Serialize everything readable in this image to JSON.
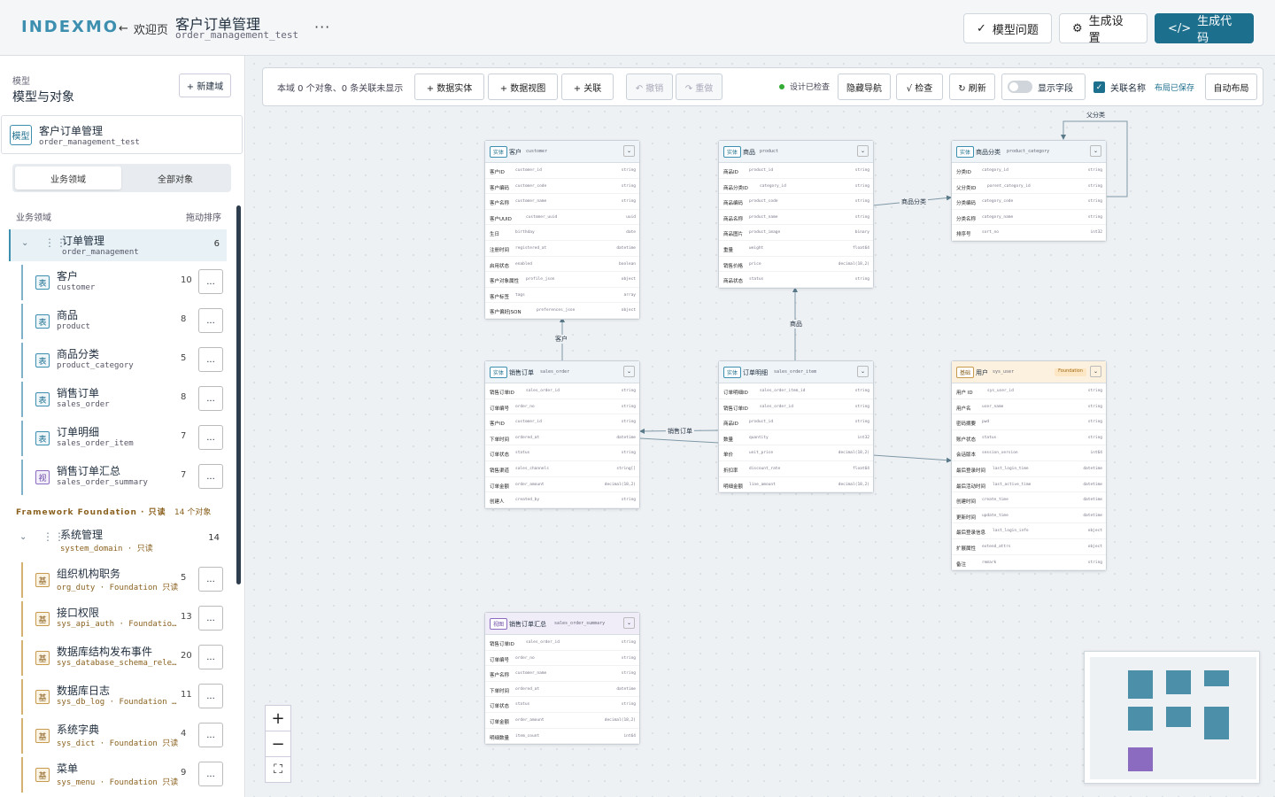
{
  "header": {
    "logo": "INDEXMO",
    "back_label": "欢迎页",
    "title": "客户订单管理",
    "subtitle": "order_management_test",
    "more": "···",
    "buttons": {
      "model_issues": "模型问题",
      "gen_settings": "生成设置",
      "gen_code": "生成代码"
    }
  },
  "sidebar": {
    "top_label": "模型",
    "top_title": "模型与对象",
    "new_domain": "+ 新建域",
    "model": {
      "badge": "模型",
      "name": "客户订单管理",
      "code": "order_management_test"
    },
    "tabs": [
      "业务领域",
      "全部对象"
    ],
    "domain_header": "业务领域",
    "drag_header": "拖动排序",
    "domain": {
      "name": "订单管理",
      "code": "order_management",
      "count": "6"
    },
    "entities": [
      {
        "badge": "表",
        "name": "客户",
        "code": "customer",
        "count": "10"
      },
      {
        "badge": "表",
        "name": "商品",
        "code": "product",
        "count": "8"
      },
      {
        "badge": "表",
        "name": "商品分类",
        "code": "product_category",
        "count": "5"
      },
      {
        "badge": "表",
        "name": "销售订单",
        "code": "sales_order",
        "count": "8"
      },
      {
        "badge": "表",
        "name": "订单明细",
        "code": "sales_order_item",
        "count": "7"
      },
      {
        "badge": "视",
        "name": "销售订单汇总",
        "code": "sales_order_summary",
        "count": "7"
      }
    ],
    "framework_header": "Framework Foundation · 只读",
    "framework_count": "14 个对象",
    "fw_domain": {
      "name": "系统管理",
      "code": "system_domain · 只读",
      "count": "14"
    },
    "fw_entities": [
      {
        "badge": "基",
        "name": "组织机构职务",
        "code": "org_duty · Foundation 只读",
        "count": "5"
      },
      {
        "badge": "基",
        "name": "接口权限",
        "code": "sys_api_auth · Foundatio…",
        "count": "13"
      },
      {
        "badge": "基",
        "name": "数据库结构发布事件",
        "code": "sys_database_schema_rele…",
        "count": "20"
      },
      {
        "badge": "基",
        "name": "数据库日志",
        "code": "sys_db_log · Foundation …",
        "count": "11"
      },
      {
        "badge": "基",
        "name": "系统字典",
        "code": "sys_dict · Foundation 只读",
        "count": "4"
      },
      {
        "badge": "基",
        "name": "菜单",
        "code": "sys_menu · Foundation 只读",
        "count": "9"
      }
    ],
    "dots": "..."
  },
  "toolbar": {
    "info": "本域 0 个对象、0 条关联未显示",
    "add_entity": "+ 数据实体",
    "add_view": "+ 数据视图",
    "add_rel": "+ 关联",
    "undo": "↶ 撤销",
    "redo": "↷ 重做",
    "check_status": "设计已检查",
    "hide_nav": "隐藏导航",
    "check": "√ 检查",
    "refresh": "↻ 刷新",
    "show_fields": "显示字段",
    "rel_names": "关联名称",
    "saved": "布局已保存",
    "auto_layout": "自动布局"
  },
  "edges": {
    "customer": "客户",
    "product": "商品",
    "category": "商品分类",
    "parent": "父分类",
    "order": "销售订单"
  },
  "cards": {
    "customer": {
      "tag": "实体",
      "name": "客户",
      "code": "customer",
      "fields": [
        [
          "客户ID",
          "customer_id",
          "string"
        ],
        [
          "客户编码",
          "customer_code",
          "string"
        ],
        [
          "客户名称",
          "customer_name",
          "string"
        ],
        [
          "客户UUID",
          "customer_uuid",
          "uuid"
        ],
        [
          "生日",
          "birthday",
          "date"
        ],
        [
          "注册时间",
          "registered_at",
          "datetime"
        ],
        [
          "启用状态",
          "enabled",
          "boolean"
        ],
        [
          "客户对象属性",
          "profile_json",
          "object"
        ],
        [
          "客户标签",
          "tags",
          "array"
        ],
        [
          "客户偏好JSON",
          "preferences_json",
          "object"
        ]
      ]
    },
    "product": {
      "tag": "实体",
      "name": "商品",
      "code": "product",
      "fields": [
        [
          "商品ID",
          "product_id",
          "string"
        ],
        [
          "商品分类ID",
          "category_id",
          "string"
        ],
        [
          "商品编码",
          "product_code",
          "string"
        ],
        [
          "商品名称",
          "product_name",
          "string"
        ],
        [
          "商品图片",
          "product_image",
          "binary"
        ],
        [
          "重量",
          "weight",
          "float64"
        ],
        [
          "销售价格",
          "price",
          "decimal(18,2)"
        ],
        [
          "商品状态",
          "status",
          "string"
        ]
      ]
    },
    "category": {
      "tag": "实体",
      "name": "商品分类",
      "code": "product_category",
      "fields": [
        [
          "分类ID",
          "category_id",
          "string"
        ],
        [
          "父分类ID",
          "parent_category_id",
          "string"
        ],
        [
          "分类编码",
          "category_code",
          "string"
        ],
        [
          "分类名称",
          "category_name",
          "string"
        ],
        [
          "排序号",
          "sort_no",
          "int32"
        ]
      ]
    },
    "order": {
      "tag": "实体",
      "name": "销售订单",
      "code": "sales_order",
      "fields": [
        [
          "销售订单ID",
          "sales_order_id",
          "string"
        ],
        [
          "订单编号",
          "order_no",
          "string"
        ],
        [
          "客户ID",
          "customer_id",
          "string"
        ],
        [
          "下单时间",
          "ordered_at",
          "datetime"
        ],
        [
          "订单状态",
          "status",
          "string"
        ],
        [
          "销售渠道",
          "sales_channels",
          "string[]"
        ],
        [
          "订单金额",
          "order_amount",
          "decimal(18,2)"
        ],
        [
          "创建人",
          "created_by",
          "string"
        ]
      ]
    },
    "item": {
      "tag": "实体",
      "name": "订单明细",
      "code": "sales_order_item",
      "fields": [
        [
          "订单明细ID",
          "sales_order_item_id",
          "string"
        ],
        [
          "销售订单ID",
          "sales_order_id",
          "string"
        ],
        [
          "商品ID",
          "product_id",
          "string"
        ],
        [
          "数量",
          "quantity",
          "int32"
        ],
        [
          "单价",
          "unit_price",
          "decimal(18,2)"
        ],
        [
          "折扣率",
          "discount_rate",
          "float64"
        ],
        [
          "明细金额",
          "line_amount",
          "decimal(18,2)"
        ]
      ]
    },
    "user": {
      "tag": "基础",
      "name": "用户",
      "code": "sys_user",
      "badge": "Foundation",
      "fields": [
        [
          "用户 ID",
          "sys_user_id",
          "string"
        ],
        [
          "用户名",
          "user_name",
          "string"
        ],
        [
          "密码摘要",
          "pwd",
          "string"
        ],
        [
          "账户状态",
          "status",
          "string"
        ],
        [
          "会话版本",
          "session_version",
          "int64"
        ],
        [
          "最后登录时间",
          "last_login_time",
          "datetime"
        ],
        [
          "最后活动时间",
          "last_active_time",
          "datetime"
        ],
        [
          "创建时间",
          "create_time",
          "datetime"
        ],
        [
          "更新时间",
          "update_time",
          "datetime"
        ],
        [
          "最后登录信息",
          "last_login_info",
          "object"
        ],
        [
          "扩展属性",
          "extend_attrs",
          "object"
        ],
        [
          "备注",
          "remark",
          "string"
        ]
      ]
    },
    "summary": {
      "tag": "视图",
      "name": "销售订单汇总",
      "code": "sales_order_summary",
      "fields": [
        [
          "销售订单ID",
          "sales_order_id",
          "string"
        ],
        [
          "订单编号",
          "order_no",
          "string"
        ],
        [
          "客户名称",
          "customer_name",
          "string"
        ],
        [
          "下单时间",
          "ordered_at",
          "datetime"
        ],
        [
          "订单状态",
          "status",
          "string"
        ],
        [
          "订单金额",
          "order_amount",
          "decimal(18,2)"
        ],
        [
          "明细数量",
          "item_count",
          "int64"
        ]
      ]
    }
  },
  "zoom": {
    "in": "+",
    "out": "−",
    "fit": "⛶"
  },
  "colors": {
    "accent": "#1d6f8e",
    "brand": "#3d8fb0",
    "view": "#8a6bbf",
    "foundation": "#c79a4e"
  }
}
